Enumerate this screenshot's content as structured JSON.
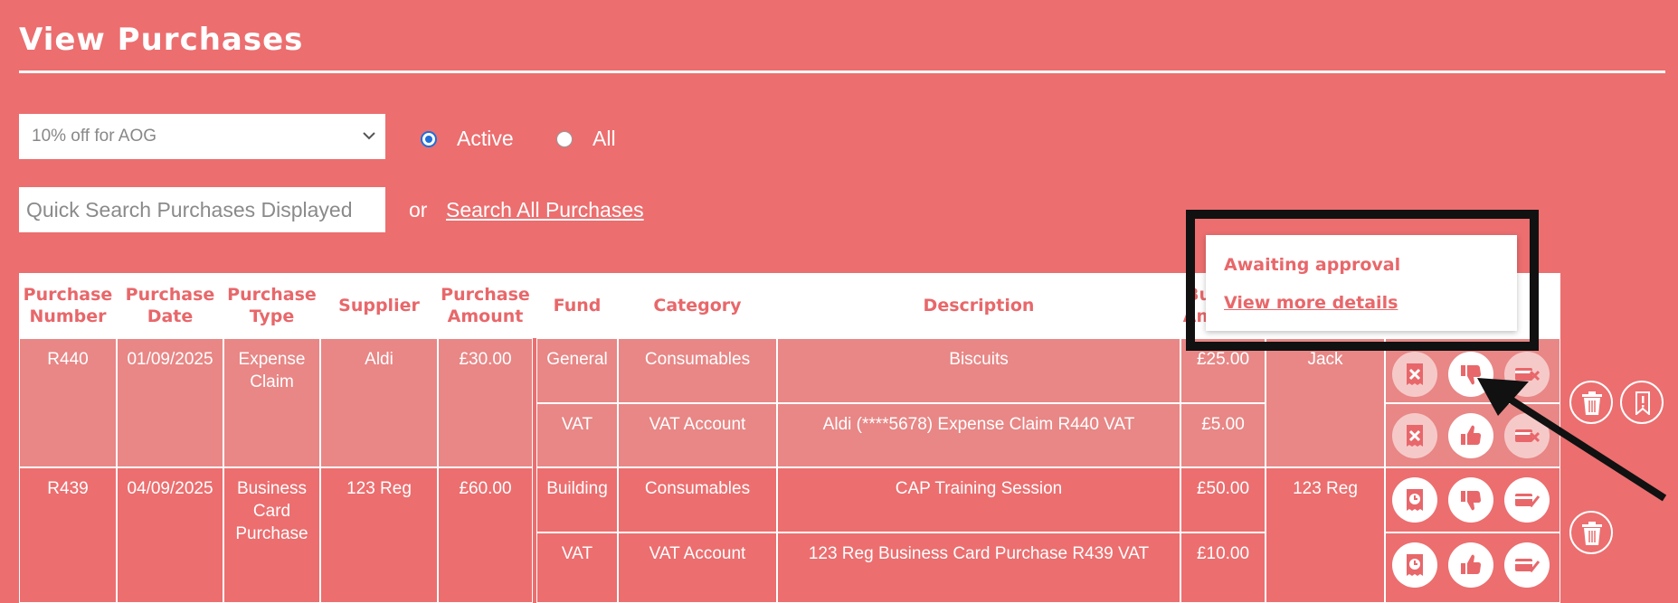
{
  "page": {
    "title": "View Purchases"
  },
  "filters": {
    "purchase_select": {
      "selected": "10% off for AOG"
    },
    "radio_active": {
      "label": "Active",
      "checked": true
    },
    "radio_all": {
      "label": "All",
      "checked": false
    },
    "search": {
      "placeholder": "Quick Search Purchases Displayed"
    },
    "or_text": "or",
    "search_all_link": "Search All Purchases"
  },
  "table": {
    "headers": [
      "Purchase Number",
      "Purchase Date",
      "Purchase Type",
      "Supplier",
      "Purchase Amount",
      "Fund",
      "Category",
      "Description",
      "Bu Am",
      "",
      ""
    ],
    "purchases": [
      {
        "number": "R440",
        "date": "01/09/2025",
        "type": "Expense Claim",
        "supplier": "Aldi",
        "amount": "£30.00",
        "owner": "Jack",
        "lines": [
          {
            "fund": "General",
            "category": "Consumables",
            "description": "Biscuits",
            "budget_amount": "£25.00"
          },
          {
            "fund": "VAT",
            "category": "VAT Account",
            "description": "Aldi (****5678) Expense Claim R440 VAT",
            "budget_amount": "£5.00"
          }
        ]
      },
      {
        "number": "R439",
        "date": "04/09/2025",
        "type": "Business Card Purchase",
        "supplier": "123 Reg",
        "amount": "£60.00",
        "owner": "123 Reg",
        "lines": [
          {
            "fund": "Building",
            "category": "Consumables",
            "description": "CAP Training Session",
            "budget_amount": "£50.00"
          },
          {
            "fund": "VAT",
            "category": "VAT Account",
            "description": "123 Reg Business Card Purchase R439 VAT",
            "budget_amount": "£10.00"
          }
        ]
      }
    ]
  },
  "icons": {
    "reject_receipt": "receipt-x-icon",
    "receipt_pending": "receipt-clock-icon",
    "thumbs_down": "thumbs-down-icon",
    "thumbs_up": "thumbs-up-icon",
    "card_x": "card-x-icon",
    "card_check": "card-check-icon",
    "delete": "trash-icon",
    "alert": "alert-icon"
  },
  "popup": {
    "status": "Awaiting approval",
    "details_link": "View more details"
  }
}
